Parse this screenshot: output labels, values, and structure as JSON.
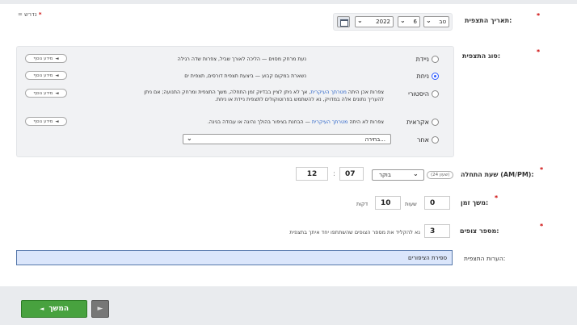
{
  "legend": {
    "text": "= נדרש",
    "star": "*"
  },
  "date": {
    "label": "תאריך התצפית:",
    "day": "טב",
    "month": "6",
    "year": "2022"
  },
  "type": {
    "label": "סוג התצפית:",
    "options": [
      {
        "label": "ניידת",
        "desc": "נעת מרחק מסוים — הליכה לאורך שביל, צפרות שדה רגילה",
        "more": "מידע נוסף",
        "selected": false
      },
      {
        "label": "ניחת",
        "desc": "נשארת במקום קבוע — ביצעת תצפית דורסים, תצפית ים",
        "more": "מידע נוסף",
        "selected": true
      },
      {
        "label": "היסטורי",
        "desc_pre": "צפרות אכן היתה ",
        "desc_link": "מטרתך העיקרית",
        "desc_post": ", אך לא ניתן לציין בבדיוק זמן התחלה, משך התצפית ומרחק התנועה; אם ניתן",
        "desc2": "להעריך נתונים אלה במדויק, נא להשתמש בפרוטוקולים לתצפית ניידת או ניחת.",
        "more": "מידע נוסף",
        "selected": false
      },
      {
        "label": "אקראית",
        "desc_pre": "צפרות לא היתה ",
        "desc_link": "מטרתך העיקרית",
        "desc_post": " — הבחנת בציפור בהולך נהיגה או עבודה בגינה.",
        "more": "מידע נוסף",
        "selected": false
      },
      {
        "label": "אחר",
        "select_value": "בחירה...",
        "selected": false
      }
    ]
  },
  "start": {
    "label": "שעת התחלה (AM/PM):",
    "hour": "12",
    "minute": "07",
    "ampm": "בוקר",
    "badge": "(שעון 24)"
  },
  "duration": {
    "label": "משך זמן:",
    "hours": "0",
    "hours_unit": "שעות",
    "minutes": "10",
    "minutes_unit": "דקות"
  },
  "observers": {
    "label": "מספר צופים:",
    "value": "3",
    "hint": "נא להקליד את מספר הצופים שהשתתפו יחד איתך בתצפית"
  },
  "notes": {
    "label": "הערות התצפית:",
    "value": "ספירת הציפורים"
  },
  "footer": {
    "continue_label": "המשך",
    "continue_arrow": "◄",
    "back_arrow": "►"
  }
}
